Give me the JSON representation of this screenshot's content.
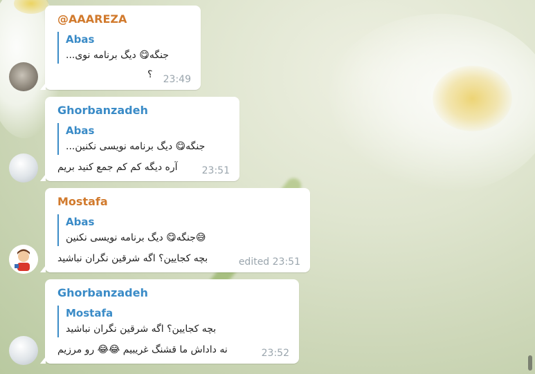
{
  "messages": [
    {
      "sender": "@AAAREZA",
      "reply": {
        "name": "Abas",
        "text": "جنگه😋 دیگ برنامه نوی..."
      },
      "text": "؟",
      "time": "23:49",
      "avatar": "rock-avatar"
    },
    {
      "sender": "Ghorbanzadeh",
      "reply": {
        "name": "Abas",
        "text": "جنگه😋 دیگ برنامه نویسی نکنین..."
      },
      "text": "آره دیگه کم کم جمع کنید بریم",
      "time": "23:51",
      "avatar": "ball-avatar"
    },
    {
      "sender": "Mostafa",
      "reply": {
        "name": "Abas",
        "text": "😅جنگه😋 دیگ برنامه نویسی نکنین"
      },
      "text": "بچه کجایین؟ اگه شرقین نگران نباشید",
      "time": "edited 23:51",
      "avatar": "cartoon-avatar"
    },
    {
      "sender": "Ghorbanzadeh",
      "reply": {
        "name": "Mostafa",
        "text": "بچه کجایین؟ اگه شرقین نگران نباشید"
      },
      "text": "نه داداش ما قشنگ غریبیم 😂😂 رو مرزیم",
      "time": "23:52",
      "avatar": "ball-avatar"
    }
  ],
  "colors": {
    "sender_orange": "#d17a2d",
    "sender_blue": "#3a8bc7",
    "time_gray": "#9aa5ad"
  }
}
